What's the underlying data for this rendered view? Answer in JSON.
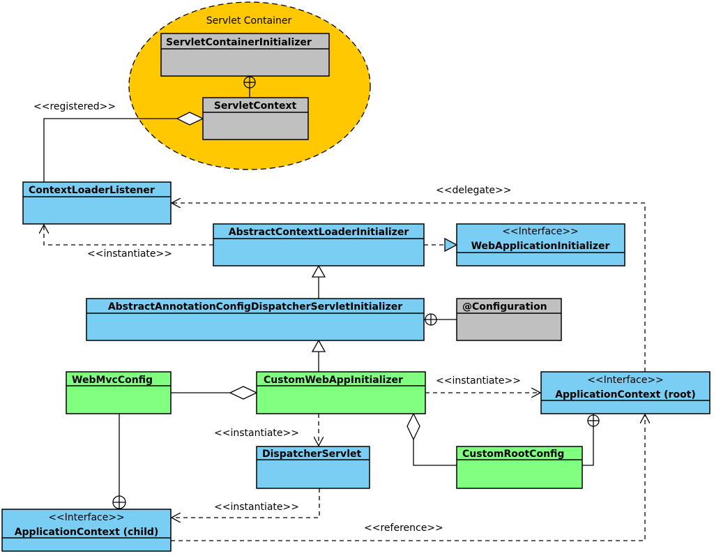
{
  "colors": {
    "container": "#FFC800",
    "gray": "#C0C0C0",
    "blue": "#7ACEF4",
    "green": "#80FF80"
  },
  "container": {
    "title": "Servlet Container"
  },
  "classes": {
    "sci": {
      "name": "ServletContainerInitializer"
    },
    "sc": {
      "name": "ServletContext"
    },
    "cll": {
      "name": "ContextLoaderListener"
    },
    "acli": {
      "name": "AbstractContextLoaderInitializer"
    },
    "wai": {
      "stereotype": "<<Interface>>",
      "name": "WebApplicationInitializer"
    },
    "aacdsi": {
      "name": "AbstractAnnotationConfigDispatcherServletInitializer"
    },
    "conf": {
      "name": "@Configuration"
    },
    "wmc": {
      "name": "WebMvcConfig"
    },
    "cwai": {
      "name": "CustomWebAppInitializer"
    },
    "acroot": {
      "stereotype": "<<Interface>>",
      "name": "ApplicationContext (root)"
    },
    "ds": {
      "name": "DispatcherServlet"
    },
    "crc": {
      "name": "CustomRootConfig"
    },
    "acchild": {
      "stereotype": "<<Interface>>",
      "name": "ApplicationContext (child)"
    }
  },
  "labels": {
    "registered": "<<registered>>",
    "delegate": "<<delegate>>",
    "instantiate_cll": "<<instantiate>>",
    "instantiate_root": "<<instantiate>>",
    "instantiate_ds": "<<instantiate>>",
    "instantiate_child": "<<instantiate>>",
    "reference": "<<reference>>"
  }
}
